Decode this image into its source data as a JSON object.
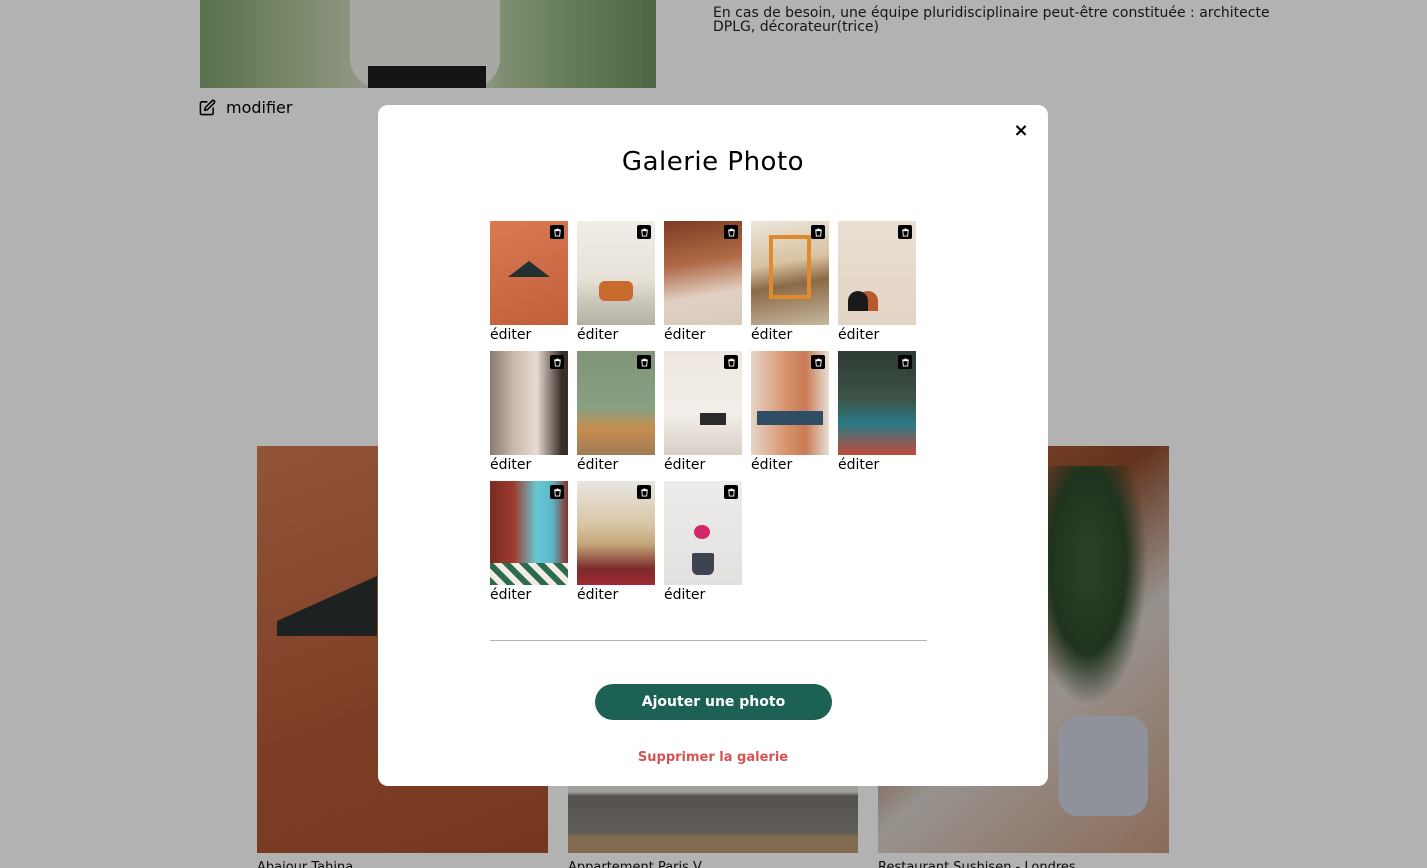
{
  "background": {
    "modifier_label": "modifier",
    "about_text": "En cas de besoin, une équipe pluridisciplinaire peut-être constituée : architecte DPLG, décorateur(trice)",
    "works": [
      {
        "title": "Abajour Tahina"
      },
      {
        "title": "Appartement Paris V"
      },
      {
        "title": "Restaurant Sushisen - Londres"
      }
    ]
  },
  "modal": {
    "title": "Galerie Photo",
    "close_icon": "×",
    "gallery": [
      {
        "edit_label": "éditer"
      },
      {
        "edit_label": "éditer"
      },
      {
        "edit_label": "éditer"
      },
      {
        "edit_label": "éditer"
      },
      {
        "edit_label": "éditer"
      },
      {
        "edit_label": "éditer"
      },
      {
        "edit_label": "éditer"
      },
      {
        "edit_label": "éditer"
      },
      {
        "edit_label": "éditer"
      },
      {
        "edit_label": "éditer"
      },
      {
        "edit_label": "éditer"
      },
      {
        "edit_label": "éditer"
      },
      {
        "edit_label": "éditer"
      }
    ],
    "add_button_label": "Ajouter une photo",
    "delete_gallery_label": "Supprimer la galerie"
  },
  "colors": {
    "primary": "#1d6154",
    "danger": "#d65353",
    "overlay": "rgba(0,0,0,0.30)"
  }
}
